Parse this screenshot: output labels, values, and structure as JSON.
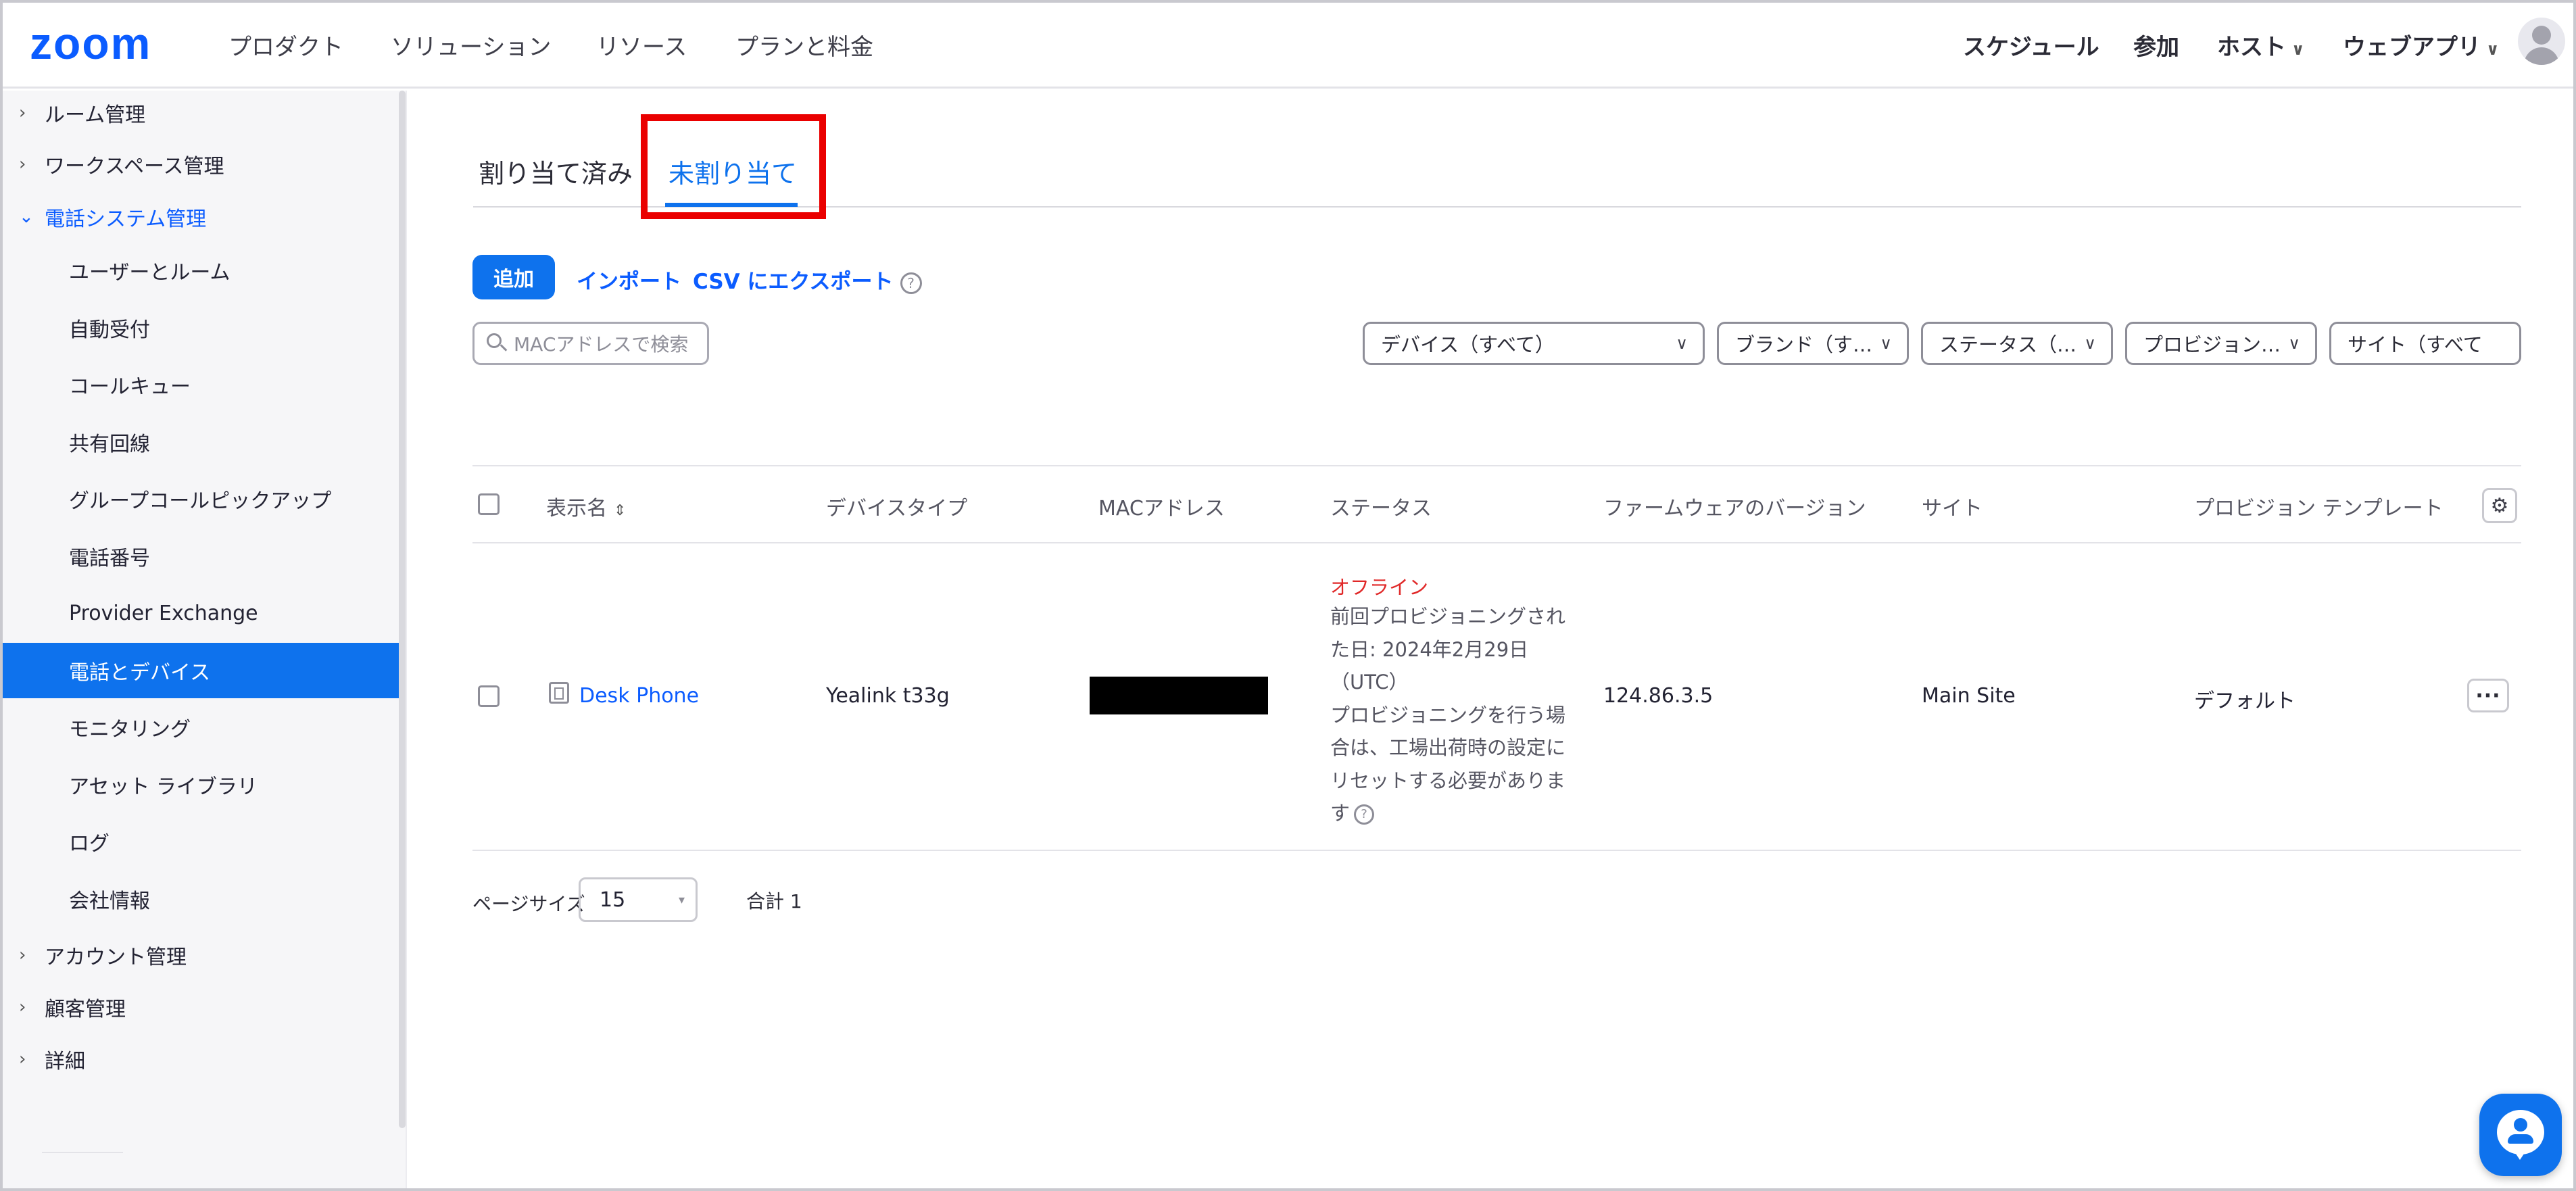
{
  "brand": {
    "logo": "zoom",
    "accent": "#0b5cff",
    "active_bg": "#0e72ed"
  },
  "topnav": {
    "left": [
      "プロダクト",
      "ソリューション",
      "リソース",
      "プランと料金"
    ],
    "schedule": "スケジュール",
    "join": "参加",
    "host": "ホスト",
    "webapp": "ウェブアプリ"
  },
  "sidebar": {
    "room_admin": "ルーム管理",
    "workspace_admin": "ワークスペース管理",
    "phone_admin": "電話システム管理",
    "sub": [
      "ユーザーとルーム",
      "自動受付",
      "コールキュー",
      "共有回線",
      "グループコールピックアップ",
      "電話番号",
      "Provider Exchange",
      "電話とデバイス",
      "モニタリング",
      "アセット ライブラリ",
      "ログ",
      "会社情報"
    ],
    "account_admin": "アカウント管理",
    "customer_admin": "顧客管理",
    "advanced": "詳細"
  },
  "tabs": {
    "assigned": "割り当て済み",
    "unassigned": "未割り当て"
  },
  "toolbar": {
    "add": "追加",
    "import": "インポート",
    "export": "CSV にエクスポート",
    "search_placeholder": "MACアドレスで検索"
  },
  "filters": {
    "device": "デバイス（すべて）",
    "brand": "ブランド（す…",
    "status": "ステータス（…",
    "provision": "プロビジョン…",
    "site": "サイト（すべて"
  },
  "table": {
    "headers": [
      "表示名",
      "デバイスタイプ",
      "MACアドレス",
      "ステータス",
      "ファームウェアのバージョン",
      "サイト",
      "プロビジョン テンプレート"
    ],
    "rows": [
      {
        "name": "Desk Phone",
        "device_type": "Yealink t33g",
        "status": "オフライン",
        "status_lines": [
          "前回プロビジョニングされ",
          "た日: 2024年2月29日",
          "（UTC）",
          "プロビジョニングを行う場",
          "合は、工場出荷時の設定に",
          "リセットする必要がありま",
          "す"
        ],
        "firmware": "124.86.3.5",
        "site": "Main Site",
        "template": "デフォルト"
      }
    ]
  },
  "footer": {
    "page_size_label": "ページサイズ",
    "page_size": "15",
    "total": "合計 1"
  }
}
